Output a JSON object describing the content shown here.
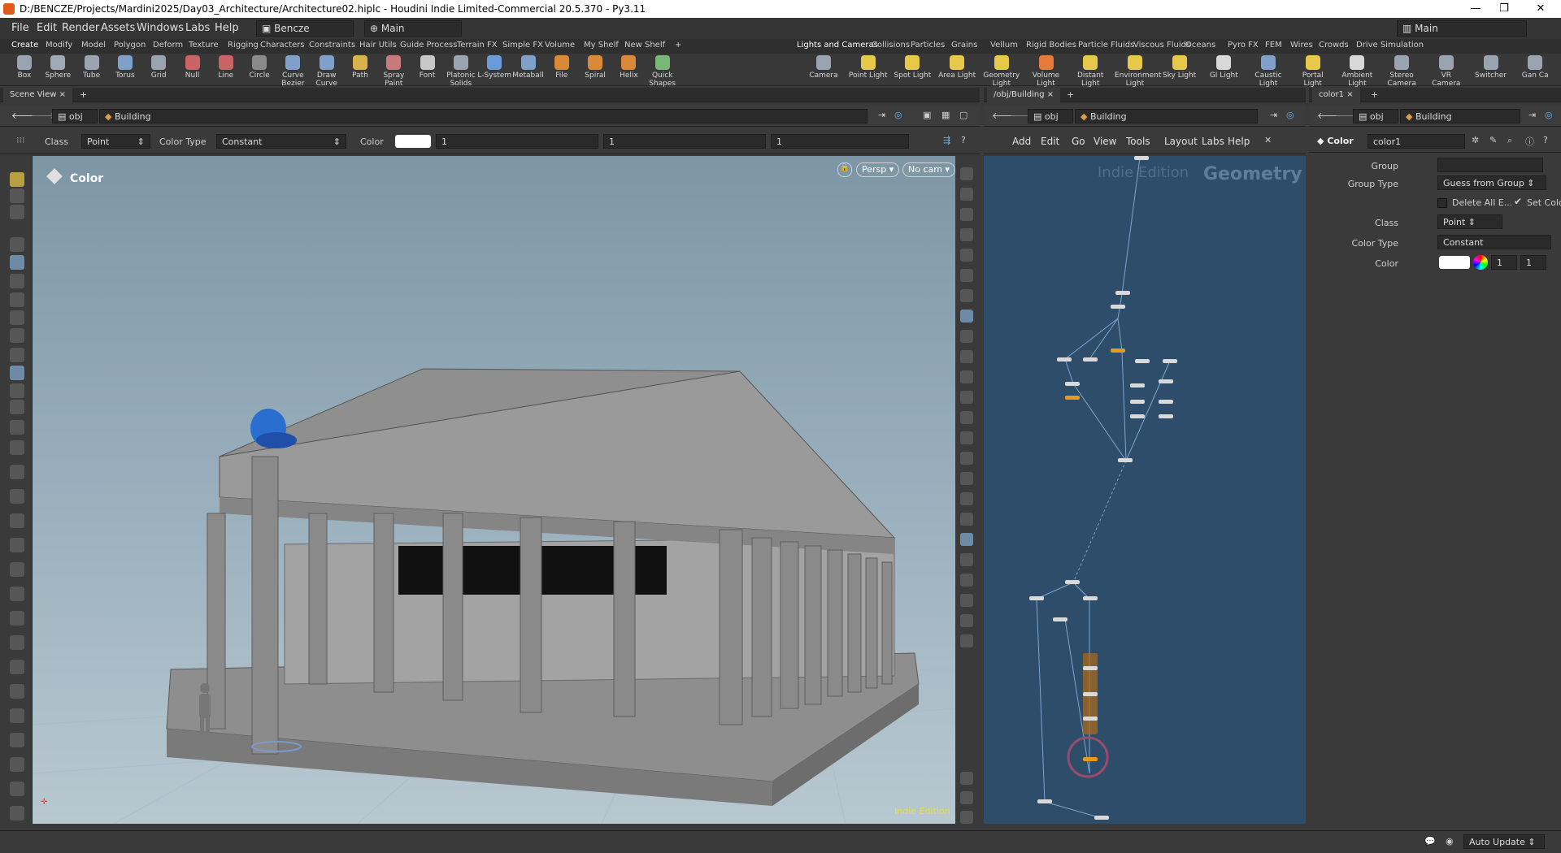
{
  "title": "D:/BENCZE/Projects/Mardini2025/Day03_Architecture/Architecture02.hiplc - Houdini Indie Limited-Commercial 20.5.370 - Py3.11",
  "menu": [
    "File",
    "Edit",
    "Render",
    "Assets",
    "Windows",
    "Labs",
    "Help"
  ],
  "desktop": "Bencze",
  "main_label": "Main",
  "right_main_label": "Main",
  "shelf_tabs_left": [
    "Create",
    "Modify",
    "Model",
    "Polygon",
    "Deform",
    "Texture",
    "Rigging",
    "Characters",
    "Constraints",
    "Hair Utils",
    "Guide Process",
    "Terrain FX",
    "Simple FX",
    "Volume",
    "My Shelf",
    "New Shelf"
  ],
  "shelf_tabs_right": [
    "Lights and Cameras",
    "Collisions",
    "Particles",
    "Grains",
    "Vellum",
    "Rigid Bodies",
    "Particle Fluids",
    "Viscous Fluids",
    "Oceans",
    "Pyro FX",
    "FEM",
    "Wires",
    "Crowds",
    "Drive Simulation"
  ],
  "tools_left": [
    {
      "label": "Box",
      "icon": "box-icon",
      "color": "#9aa4b1"
    },
    {
      "label": "Sphere",
      "icon": "sphere-icon",
      "color": "#a0aab6"
    },
    {
      "label": "Tube",
      "icon": "tube-icon",
      "color": "#9aa4b1"
    },
    {
      "label": "Torus",
      "icon": "torus-icon",
      "color": "#7fa0c8"
    },
    {
      "label": "Grid",
      "icon": "grid-icon",
      "color": "#9aa4b1"
    },
    {
      "label": "Null",
      "icon": "null-icon",
      "color": "#c86464"
    },
    {
      "label": "Line",
      "icon": "line-icon",
      "color": "#c86464"
    },
    {
      "label": "Circle",
      "icon": "circle-icon",
      "color": "#8a8a8a"
    },
    {
      "label": "Curve Bezier",
      "icon": "bezier-icon",
      "color": "#7fa0c8"
    },
    {
      "label": "Draw Curve",
      "icon": "draw-curve-icon",
      "color": "#7fa0c8"
    },
    {
      "label": "Path",
      "icon": "path-icon",
      "color": "#d8b24a"
    },
    {
      "label": "Spray Paint",
      "icon": "spray-icon",
      "color": "#c87a7a"
    },
    {
      "label": "Font",
      "icon": "font-icon",
      "color": "#c8c8c8"
    },
    {
      "label": "Platonic Solids",
      "icon": "platonic-icon",
      "color": "#9aa4b1"
    },
    {
      "label": "L-System",
      "icon": "lsystem-icon",
      "color": "#6a9ad8"
    },
    {
      "label": "Metaball",
      "icon": "metaball-icon",
      "color": "#7fa0c8"
    },
    {
      "label": "File",
      "icon": "file-icon",
      "color": "#d88a3a"
    },
    {
      "label": "Spiral",
      "icon": "spiral-icon",
      "color": "#d88a3a"
    },
    {
      "label": "Helix",
      "icon": "helix-icon",
      "color": "#d88a3a"
    },
    {
      "label": "Quick Shapes",
      "icon": "quickshapes-icon",
      "color": "#7ab87a"
    }
  ],
  "tools_right": [
    {
      "label": "Camera",
      "icon": "camera-icon",
      "color": "#9aa4b1"
    },
    {
      "label": "Point Light",
      "icon": "pointlight-icon",
      "color": "#e6c84a"
    },
    {
      "label": "Spot Light",
      "icon": "spotlight-icon",
      "color": "#e6c84a"
    },
    {
      "label": "Area Light",
      "icon": "arealight-icon",
      "color": "#e6c84a"
    },
    {
      "label": "Geometry Light",
      "icon": "geolight-icon",
      "color": "#e6c84a"
    },
    {
      "label": "Volume Light",
      "icon": "volumelight-icon",
      "color": "#e67a3a"
    },
    {
      "label": "Distant Light",
      "icon": "distantlight-icon",
      "color": "#e6c84a"
    },
    {
      "label": "Environment Light",
      "icon": "envlight-icon",
      "color": "#e6c84a"
    },
    {
      "label": "Sky Light",
      "icon": "skylight-icon",
      "color": "#e6c84a"
    },
    {
      "label": "GI Light",
      "icon": "gilight-icon",
      "color": "#d8d8d8"
    },
    {
      "label": "Caustic Light",
      "icon": "causticlight-icon",
      "color": "#7fa0c8"
    },
    {
      "label": "Portal Light",
      "icon": "portallight-icon",
      "color": "#e6c84a"
    },
    {
      "label": "Ambient Light",
      "icon": "ambientlight-icon",
      "color": "#d8d8d8"
    },
    {
      "label": "Stereo Camera",
      "icon": "stereocam-icon",
      "color": "#9aa4b1"
    },
    {
      "label": "VR Camera",
      "icon": "vrcamera-icon",
      "color": "#9aa4b1"
    },
    {
      "label": "Switcher",
      "icon": "switcher-icon",
      "color": "#9aa4b1"
    },
    {
      "label": "Gan Ca",
      "icon": "gancam-icon",
      "color": "#9aa4b1"
    }
  ],
  "scene_view": {
    "tab": "Scene View",
    "path_obj": "obj",
    "path_node": "Building",
    "class_label": "Class",
    "class_value": "Point",
    "color_type_label": "Color Type",
    "color_type_value": "Constant",
    "color_label": "Color",
    "color_values": [
      "1",
      "1",
      "1"
    ],
    "hud_title": "Color",
    "persp": "Persp ▾",
    "cam": "No cam ▾",
    "watermark": "Indie Edition"
  },
  "network": {
    "tab": "/obj/Building",
    "path_obj": "obj",
    "path_node": "Building",
    "menus": [
      "Add",
      "Edit",
      "Go",
      "View",
      "Tools",
      "Layout",
      "Labs",
      "Help"
    ],
    "watermark": "Indie Edition",
    "context": "Geometry"
  },
  "params": {
    "tab": "color1",
    "path_obj": "obj",
    "path_node": "Building",
    "node_type": "Color",
    "node_name": "color1",
    "group_label": "Group",
    "group_value": "",
    "group_type_label": "Group Type",
    "group_type_value": "Guess from Group",
    "delete_label": "Delete All E...",
    "set_color_label": "Set Colc",
    "class_label": "Class",
    "class_value": "Point",
    "color_type_label": "Color Type",
    "color_type_value": "Constant",
    "color_label": "Color",
    "color_values": [
      "1",
      "1"
    ]
  },
  "status": {
    "auto_update": "Auto Update"
  }
}
